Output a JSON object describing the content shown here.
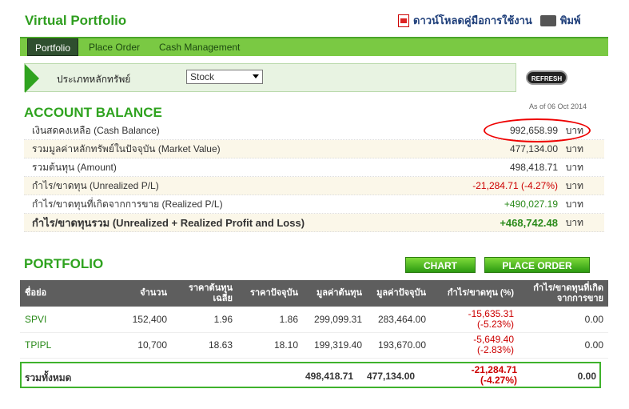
{
  "header": {
    "title": "Virtual Portfolio",
    "download": "ดาวน์โหลดคู่มือการใช้งาน",
    "print": "พิมพ์"
  },
  "tabs": [
    {
      "label": "Portfolio"
    },
    {
      "label": "Place Order"
    },
    {
      "label": "Cash Management"
    }
  ],
  "filter": {
    "label": "ประเภทหลักทรัพย์",
    "selected": "Stock",
    "refresh": "REFRESH"
  },
  "balance": {
    "title": "ACCOUNT BALANCE",
    "as_of": "As of 06 Oct 2014",
    "unit": "บาท",
    "rows": [
      {
        "label": "เงินสดคงเหลือ (Cash Balance)",
        "value": "992,658.99"
      },
      {
        "label": "รวมมูลค่าหลักทรัพย์ในปัจจุบัน (Market Value)",
        "value": "477,134.00"
      },
      {
        "label": "รวมต้นทุน (Amount)",
        "value": "498,418.71"
      },
      {
        "label": "กำไร/ขาดทุน (Unrealized P/L)",
        "value": "-21,284.71 (-4.27%)"
      },
      {
        "label": "กำไร/ขาดทุนที่เกิดจากการขาย (Realized P/L)",
        "value": "+490,027.19"
      },
      {
        "label": "กำไร/ขาดทุนรวม (Unrealized + Realized Profit and Loss)",
        "value": "+468,742.48"
      }
    ]
  },
  "portfolio": {
    "title": "PORTFOLIO",
    "chart_btn": "CHART",
    "order_btn": "PLACE ORDER",
    "headers": [
      "ชื่อย่อ",
      "จำนวน",
      "ราคาต้นทุนเฉลี่ย",
      "ราคาปัจจุบัน",
      "มูลค่าต้นทุน",
      "มูลค่าปัจจุบัน",
      "กำไร/ขาดทุน (%)",
      "กำไร/ขาดทุนที่เกิดจากการขาย"
    ],
    "rows": [
      {
        "symbol": "SPVI",
        "qty": "152,400",
        "avg": "1.96",
        "last": "1.86",
        "cost": "299,099.31",
        "market": "283,464.00",
        "pl": "-15,635.31",
        "plpct": "(-5.23%)",
        "realized": "0.00"
      },
      {
        "symbol": "TPIPL",
        "qty": "10,700",
        "avg": "18.63",
        "last": "18.10",
        "cost": "199,319.40",
        "market": "193,670.00",
        "pl": "-5,649.40",
        "plpct": "(-2.83%)",
        "realized": "0.00"
      }
    ],
    "total": {
      "label": "รวมทั้งหมด",
      "cost": "498,418.71",
      "market": "477,134.00",
      "pl": "-21,284.71",
      "plpct": "(-4.27%)",
      "realized": "0.00"
    }
  },
  "colors": {
    "green": "#2fa31f",
    "red": "#cc0000"
  }
}
